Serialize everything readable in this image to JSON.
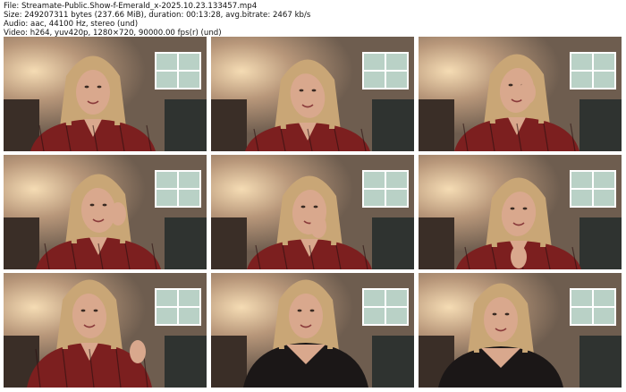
{
  "header": {
    "lines": [
      "File: Streamate-Public.Show-f-Emerald_x-2025.10.23.133457.mp4",
      "Size: 249207311 bytes (237.66 MiB), duration: 00:13:28, avg.bitrate: 2467 kb/s",
      "Audio: aac, 44100 Hz, stereo (und)",
      "Video: h264, yuv420p, 1280×720, 90000.00 fps(r) (und)"
    ]
  },
  "thumbnails": [
    {
      "pose": "center-face"
    },
    {
      "pose": "tilt-left"
    },
    {
      "pose": "hand-to-mouth"
    },
    {
      "pose": "hand-on-cheek"
    },
    {
      "pose": "finger-on-lips"
    },
    {
      "pose": "looking-down"
    },
    {
      "pose": "hands-raised"
    },
    {
      "pose": "lace-top"
    },
    {
      "pose": "smiling-lace-top"
    }
  ],
  "colors": {
    "background": "#ffffff",
    "text": "#111111",
    "lamp": "#f5dcb4",
    "wall": "#6e5d4f",
    "window": "#b9d1c6",
    "plaid": "#7c1f1f",
    "hair": "#c9a676",
    "skin": "#d9a88d",
    "lace": "#1b1717"
  }
}
